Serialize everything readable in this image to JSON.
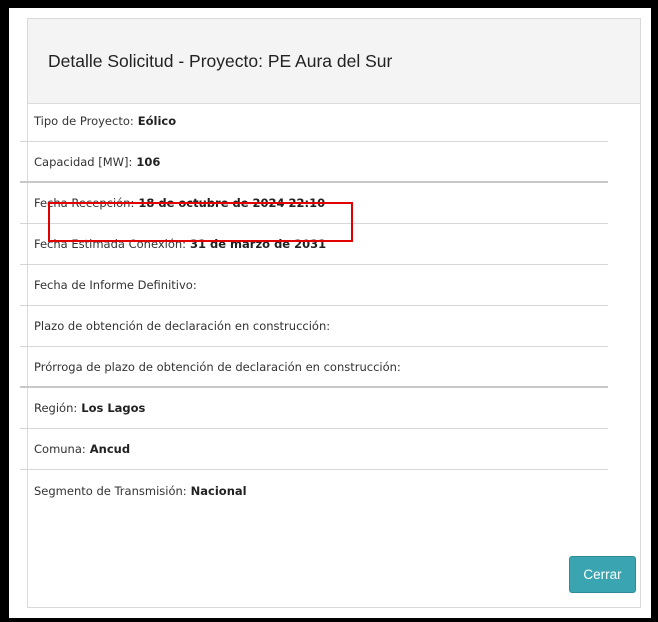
{
  "modal": {
    "title": "Detalle Solicitud - Proyecto: PE Aura del Sur",
    "close_label": "Cerrar"
  },
  "fields": [
    {
      "label": "Tipo de Proyecto:",
      "value": "Eólico"
    },
    {
      "label": "Capacidad [MW]:",
      "value": "106"
    },
    {
      "label": "Fecha Recepción:",
      "value": "18 de octubre de 2024 22:10"
    },
    {
      "label": "Fecha Estimada Conexión:",
      "value": "31 de marzo de 2031"
    },
    {
      "label": "Fecha de Informe Definitivo:",
      "value": ""
    },
    {
      "label": "Plazo de obtención de declaración en construcción:",
      "value": ""
    },
    {
      "label": "Prórroga de plazo de obtención de declaración en construcción:",
      "value": ""
    },
    {
      "label": "Región:",
      "value": "Los Lagos"
    },
    {
      "label": "Comuna:",
      "value": "Ancud"
    },
    {
      "label": "Segmento de Transmisión:",
      "value": "Nacional"
    }
  ],
  "colors": {
    "highlight": "#e00000",
    "button": "#3aa5b0"
  }
}
